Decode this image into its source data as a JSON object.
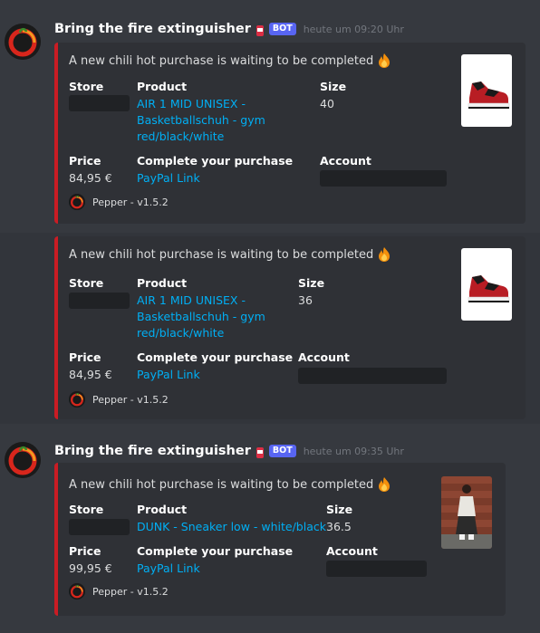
{
  "messages": [
    {
      "username": "Bring the fire extinguisher",
      "bot_tag": "BOT",
      "timestamp": "heute um 09:20 Uhr",
      "embed": {
        "description": "A new chili hot purchase is waiting to be completed",
        "store_label": "Store",
        "product_label": "Product",
        "product_lines": [
          "AIR 1 MID UNISEX -",
          "Basketballschuh - gym",
          "red/black/white"
        ],
        "size_label": "Size",
        "size_value": "40",
        "price_label": "Price",
        "price_value": "84,95 €",
        "complete_label": "Complete your purchase",
        "paypal_link": "PayPal Link",
        "account_label": "Account",
        "footer_text": "Pepper - v1.5.2"
      }
    },
    {
      "embed": {
        "description": "A new chili hot purchase is waiting to be completed",
        "store_label": "Store",
        "product_label": "Product",
        "product_lines": [
          "AIR 1 MID UNISEX -",
          "Basketballschuh - gym",
          "red/black/white"
        ],
        "size_label": "Size",
        "size_value": "36",
        "price_label": "Price",
        "price_value": "84,95 €",
        "complete_label": "Complete your purchase",
        "paypal_link": "PayPal Link",
        "account_label": "Account",
        "footer_text": "Pepper - v1.5.2"
      }
    },
    {
      "username": "Bring the fire extinguisher",
      "bot_tag": "BOT",
      "timestamp": "heute um 09:35 Uhr",
      "embed": {
        "description": "A new chili hot purchase is waiting to be completed",
        "store_label": "Store",
        "product_label": "Product",
        "product_lines": [
          "DUNK - Sneaker low - white/black"
        ],
        "size_label": "Size",
        "size_value": "36.5",
        "price_label": "Price",
        "price_value": "99,95 €",
        "complete_label": "Complete your purchase",
        "paypal_link": "PayPal Link",
        "account_label": "Account",
        "footer_text": "Pepper - v1.5.2"
      }
    }
  ],
  "colors": {
    "embed_border": "#ca1c24",
    "link": "#00aff4",
    "bot_tag": "#5865f2"
  },
  "icons": {
    "extinguisher": "fire-extinguisher-icon",
    "fire": "fire-emoji-icon",
    "avatar": "chili-pepper-avatar"
  }
}
